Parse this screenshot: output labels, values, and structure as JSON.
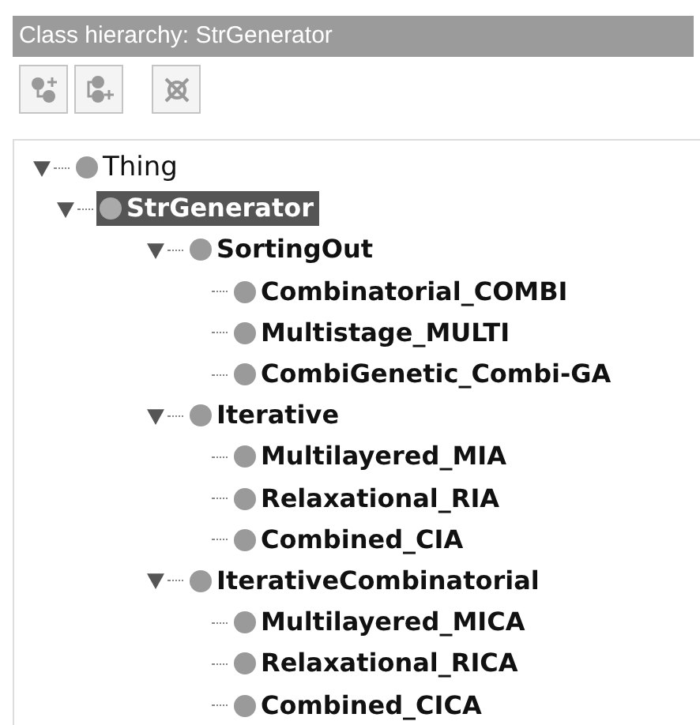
{
  "panel": {
    "title": "Class hierarchy: StrGenerator"
  },
  "tree": [
    {
      "label": "Thing",
      "expanded": true,
      "selected": false,
      "children": [
        {
          "label": "StrGenerator",
          "expanded": true,
          "selected": true,
          "children": [
            {
              "label": "SortingOut",
              "expanded": true,
              "selected": false,
              "children": [
                {
                  "label": "Combinatorial_COMBI",
                  "selected": false
                },
                {
                  "label": "Multistage_MULTI",
                  "selected": false
                },
                {
                  "label": "CombiGenetic_Combi-GA",
                  "selected": false
                }
              ]
            },
            {
              "label": "Iterative",
              "expanded": true,
              "selected": false,
              "children": [
                {
                  "label": "Multilayered_MIA",
                  "selected": false
                },
                {
                  "label": "Relaxational_RIA",
                  "selected": false
                },
                {
                  "label": "Combined_CIA",
                  "selected": false
                }
              ]
            },
            {
              "label": "IterativeCombinatorial",
              "expanded": true,
              "selected": false,
              "children": [
                {
                  "label": "Multilayered_MICA",
                  "selected": false
                },
                {
                  "label": "Relaxational_RICA",
                  "selected": false
                },
                {
                  "label": "Combined_CICA",
                  "selected": false
                }
              ]
            }
          ]
        }
      ]
    }
  ]
}
